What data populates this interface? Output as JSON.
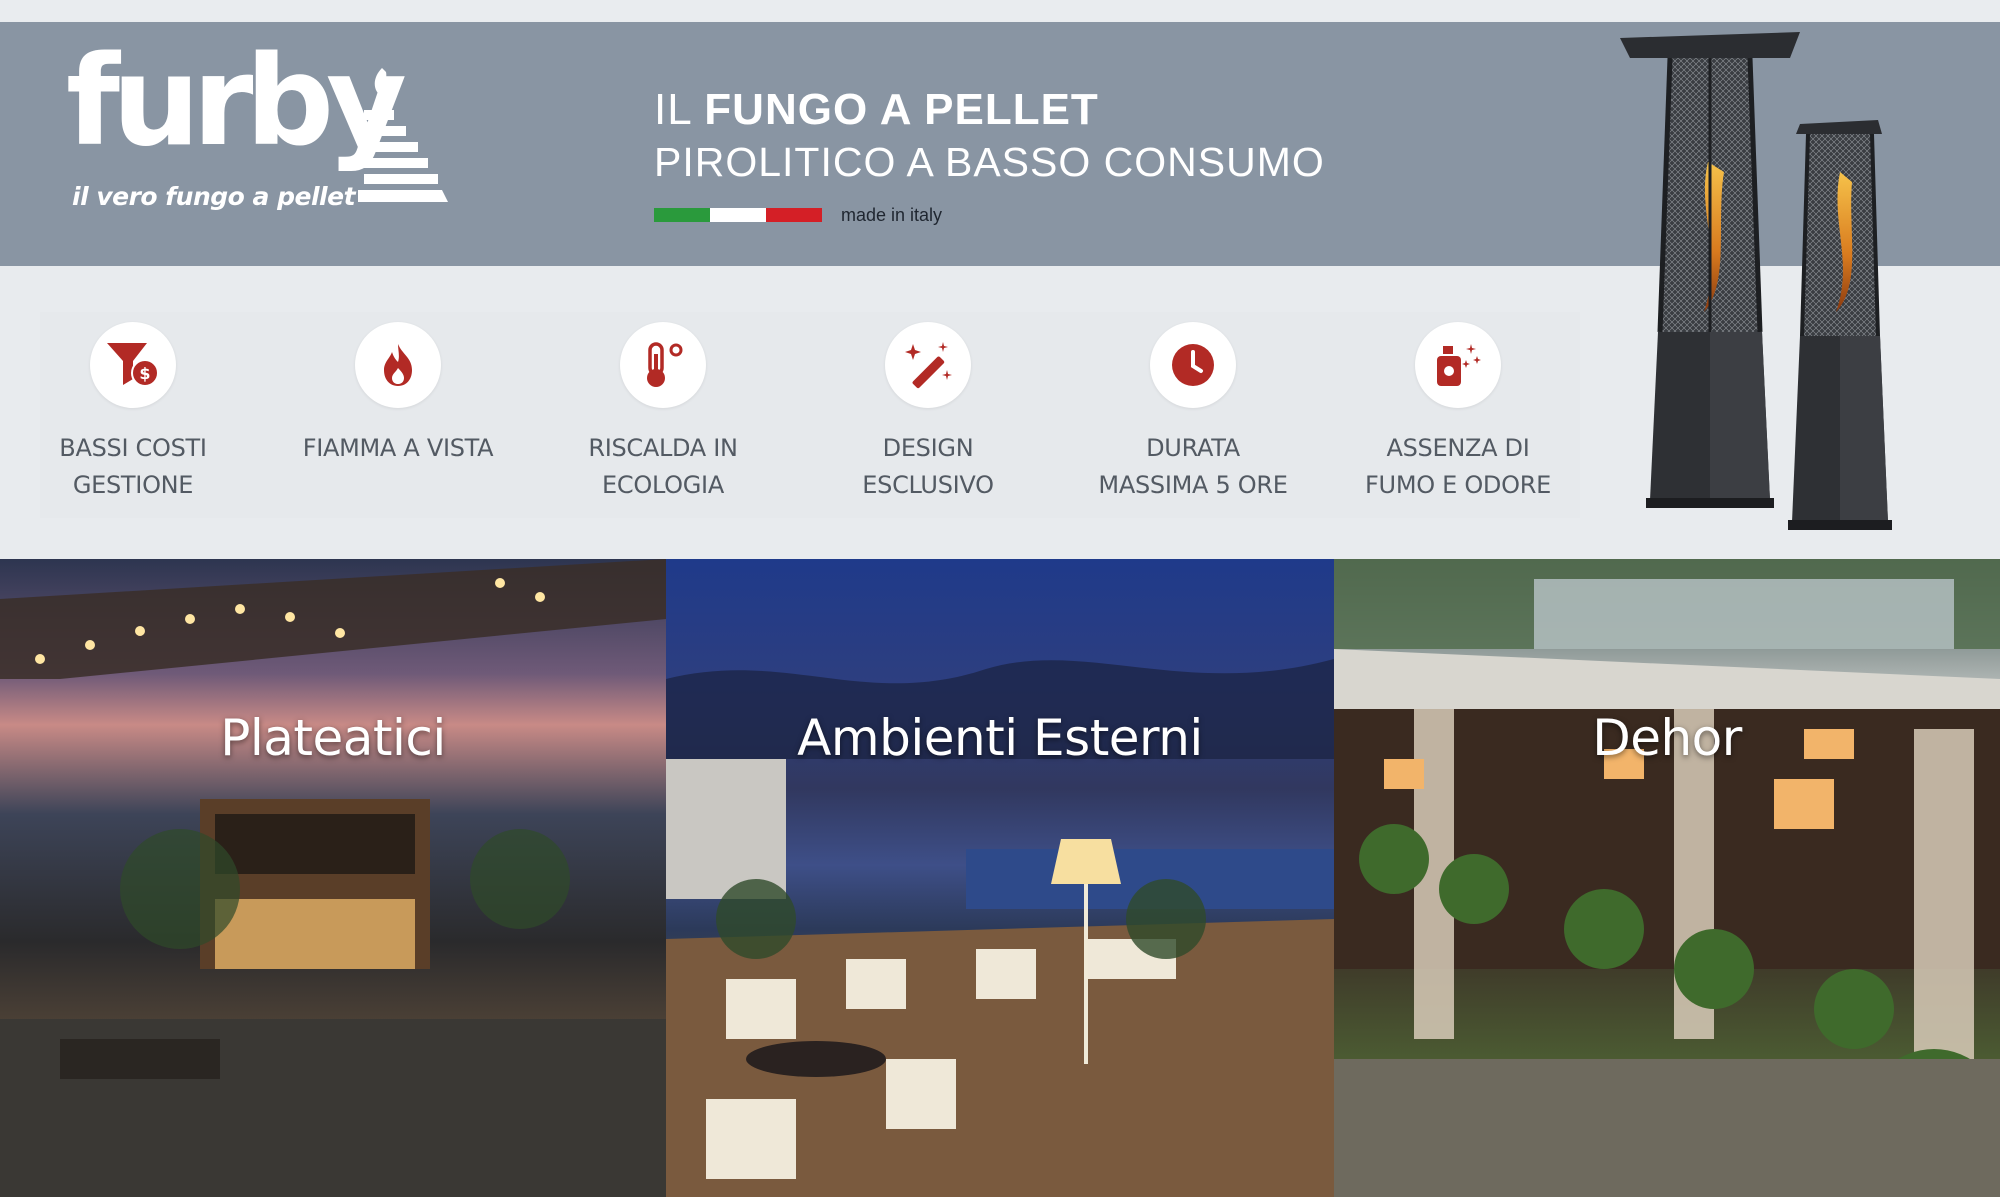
{
  "brand": {
    "logo_word": "furby",
    "logo_tagline": "il vero fungo a pellet"
  },
  "headline": {
    "prefix": "IL",
    "bold": "FUNGO A PELLET",
    "line2": "PIROLITICO A BASSO CONSUMO",
    "made_in": "made in italy",
    "flag_colors": [
      "#2a9a3c",
      "#ffffff",
      "#d41f26"
    ]
  },
  "features": [
    {
      "icon": "funnel-dollar-icon",
      "label_1": "BASSI COSTI",
      "label_2": "GESTIONE"
    },
    {
      "icon": "flame-icon",
      "label_1": "FIAMMA A VISTA",
      "label_2": ""
    },
    {
      "icon": "thermometer-icon",
      "label_1": "RISCALDA IN",
      "label_2": "ECOLOGIA"
    },
    {
      "icon": "magic-wand-icon",
      "label_1": "DESIGN",
      "label_2": "ESCLUSIVO"
    },
    {
      "icon": "clock-icon",
      "label_1": "DURATA",
      "label_2": "MASSIMA 5 ORE"
    },
    {
      "icon": "spray-bottle-icon",
      "label_1": "ASSENZA DI",
      "label_2": "FUMO E ODORE"
    }
  ],
  "photos": [
    {
      "title": "Plateatici"
    },
    {
      "title": "Ambienti Esterni"
    },
    {
      "title": "Dehor"
    }
  ],
  "colors": {
    "header_band": "#8995a3",
    "icon_red": "#b22a25",
    "feature_text": "#535a63"
  }
}
